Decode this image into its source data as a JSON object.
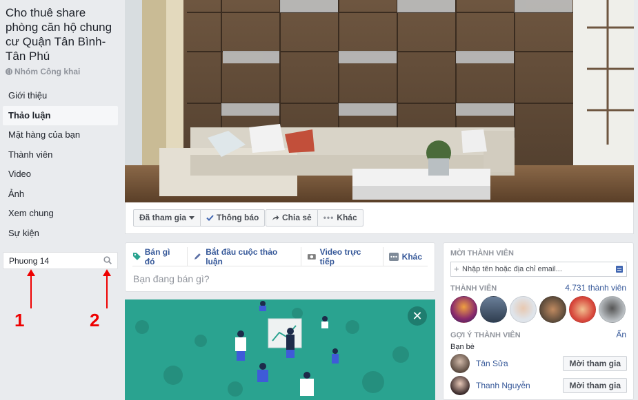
{
  "group": {
    "title": "Cho thuê share phòng căn hộ chung cư Quận Tân Bình-Tân Phú",
    "type_label": "Nhóm Công khai"
  },
  "sidebar": {
    "items": [
      {
        "label": "Giới thiệu"
      },
      {
        "label": "Thảo luận",
        "active": true
      },
      {
        "label": "Mặt hàng của bạn"
      },
      {
        "label": "Thành viên"
      },
      {
        "label": "Video"
      },
      {
        "label": "Ảnh"
      },
      {
        "label": "Xem chung"
      },
      {
        "label": "Sự kiện"
      }
    ],
    "search": {
      "value": "Phuong 14",
      "icon": "search-icon"
    }
  },
  "annotations": {
    "label_1": "1",
    "label_2": "2",
    "color": "#ee0000"
  },
  "actionbar": {
    "joined_label": "Đã tham gia",
    "notifications_label": "Thông báo",
    "share_label": "Chia sẻ",
    "more_label": "Khác"
  },
  "composer": {
    "tabs": [
      {
        "label": "Bán gì đó",
        "icon": "tag-icon"
      },
      {
        "label": "Bắt đầu cuộc thảo luận",
        "icon": "pencil-icon"
      },
      {
        "label": "Video trực tiếp",
        "icon": "camera-icon"
      },
      {
        "label": "Khác",
        "icon": "more-icon"
      }
    ],
    "placeholder": "Bạn đang bán gì?"
  },
  "rightcol": {
    "invite_heading": "MỜI THÀNH VIÊN",
    "invite_placeholder": "Nhập tên hoặc địa chỉ email...",
    "members_heading": "THÀNH VIÊN",
    "member_count": "4.731 thành viên",
    "suggest_heading": "GỢI Ý THÀNH VIÊN",
    "see_all": "Ẩn",
    "friends_label": "Bạn bè",
    "suggestions": [
      {
        "name": "Tân Sửa",
        "button": "Mời tham gia"
      },
      {
        "name": "Thanh Nguyễn",
        "button": "Mời tham gia"
      }
    ]
  },
  "colors": {
    "link": "#365899",
    "banner": "#2aa390",
    "background": "#e9ebee"
  }
}
